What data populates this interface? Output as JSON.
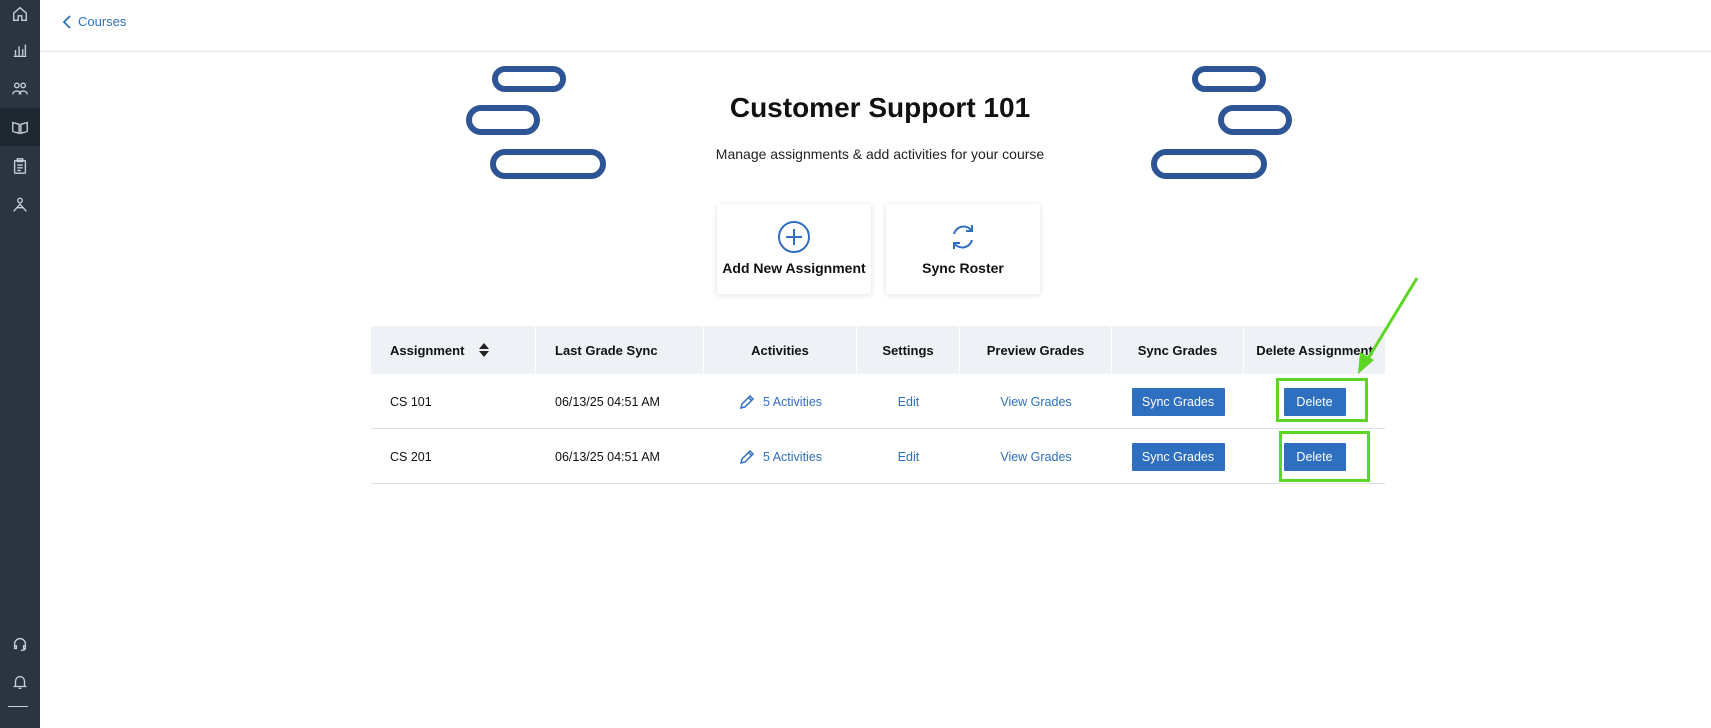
{
  "nav": {
    "back_label": "Courses"
  },
  "header": {
    "title": "Customer Support 101",
    "subtitle": "Manage assignments & add activities for your course"
  },
  "actions": {
    "add_assignment_label": "Add New Assignment",
    "sync_roster_label": "Sync Roster"
  },
  "table": {
    "columns": [
      "Assignment",
      "Last Grade Sync",
      "Activities",
      "Settings",
      "Preview Grades",
      "Sync Grades",
      "Delete Assignment"
    ],
    "rows": [
      {
        "assignment": "CS 101",
        "last_grade_sync": "06/13/25 04:51 AM",
        "activities": "5 Activities",
        "settings": "Edit",
        "preview": "View Grades",
        "sync": "Sync Grades",
        "delete": "Delete"
      },
      {
        "assignment": "CS 201",
        "last_grade_sync": "06/13/25 04:51 AM",
        "activities": "5 Activities",
        "settings": "Edit",
        "preview": "View Grades",
        "sync": "Sync Grades",
        "delete": "Delete"
      }
    ]
  },
  "colors": {
    "accent": "#2f6fc0",
    "sidebar": "#2b3440",
    "decor": "#2d5596",
    "highlight": "#5ed625"
  },
  "icons": {
    "sidebar": [
      "home-icon",
      "chart-icon",
      "users-icon",
      "book-icon",
      "clipboard-icon",
      "network-icon",
      "headset-icon",
      "bell-icon"
    ],
    "add_assignment": "plus-circle-icon",
    "sync_roster": "sync-icon",
    "activities": "pencil-icon",
    "sort": "sort-icon"
  }
}
